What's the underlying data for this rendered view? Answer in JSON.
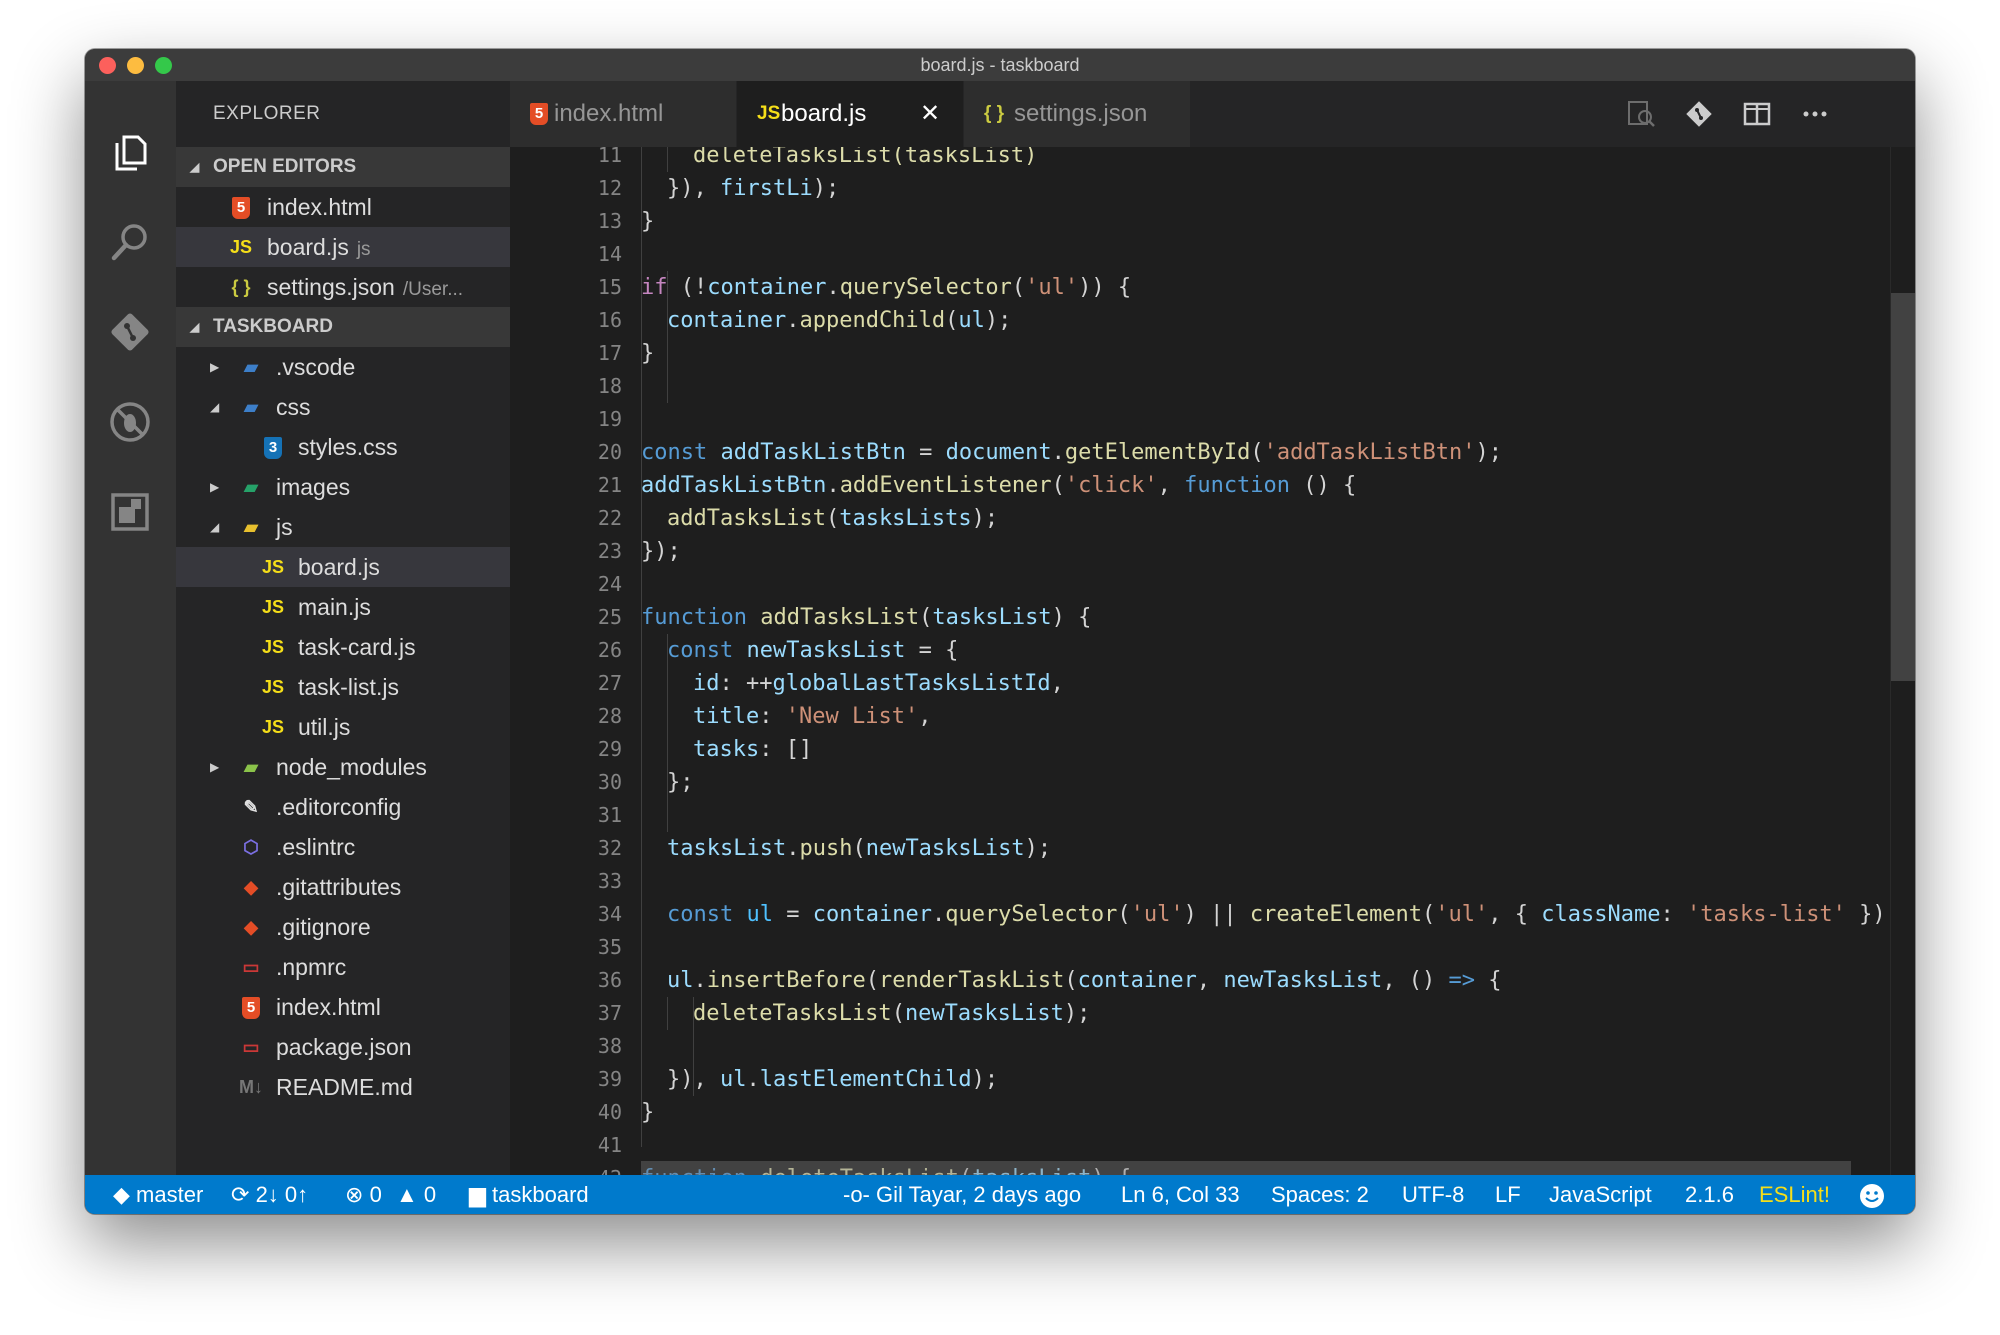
{
  "window": {
    "title": "board.js - taskboard"
  },
  "sidebar": {
    "title": "EXPLORER",
    "open_editors_label": "OPEN EDITORS",
    "open_editors": [
      {
        "icon": "html-file-icon",
        "name": "index.html",
        "desc": ""
      },
      {
        "icon": "js-file-icon",
        "name": "board.js",
        "desc": "js"
      },
      {
        "icon": "json-file-icon",
        "name": "settings.json",
        "desc": "/User..."
      }
    ],
    "project_label": "TASKBOARD",
    "tree": [
      {
        "name": ".vscode",
        "icon": "vscode-folder-icon",
        "depth": 1,
        "expanded": false,
        "folder": true
      },
      {
        "name": "css",
        "icon": "css-folder-icon",
        "depth": 1,
        "expanded": true,
        "folder": true
      },
      {
        "name": "styles.css",
        "icon": "css-file-icon",
        "depth": 2,
        "folder": false
      },
      {
        "name": "images",
        "icon": "images-folder-icon",
        "depth": 1,
        "expanded": false,
        "folder": true
      },
      {
        "name": "js",
        "icon": "js-folder-icon",
        "depth": 1,
        "expanded": true,
        "folder": true
      },
      {
        "name": "board.js",
        "icon": "js-file-icon",
        "depth": 2,
        "folder": false,
        "selected": true
      },
      {
        "name": "main.js",
        "icon": "js-file-icon",
        "depth": 2,
        "folder": false
      },
      {
        "name": "task-card.js",
        "icon": "js-file-icon",
        "depth": 2,
        "folder": false
      },
      {
        "name": "task-list.js",
        "icon": "js-file-icon",
        "depth": 2,
        "folder": false
      },
      {
        "name": "util.js",
        "icon": "js-file-icon",
        "depth": 2,
        "folder": false
      },
      {
        "name": "node_modules",
        "icon": "node-folder-icon",
        "depth": 1,
        "expanded": false,
        "folder": true
      },
      {
        "name": ".editorconfig",
        "icon": "editorconfig-file-icon",
        "depth": 1,
        "folder": false
      },
      {
        "name": ".eslintrc",
        "icon": "eslint-file-icon",
        "depth": 1,
        "folder": false
      },
      {
        "name": ".gitattributes",
        "icon": "git-file-icon",
        "depth": 1,
        "folder": false
      },
      {
        "name": ".gitignore",
        "icon": "git-file-icon",
        "depth": 1,
        "folder": false
      },
      {
        "name": ".npmrc",
        "icon": "npm-file-icon",
        "depth": 1,
        "folder": false
      },
      {
        "name": "index.html",
        "icon": "html-file-icon",
        "depth": 1,
        "folder": false
      },
      {
        "name": "package.json",
        "icon": "npm-file-icon",
        "depth": 1,
        "folder": false
      },
      {
        "name": "README.md",
        "icon": "markdown-file-icon",
        "depth": 1,
        "folder": false
      }
    ]
  },
  "tabs": [
    {
      "icon": "html-file-icon",
      "label": "index.html",
      "active": false
    },
    {
      "icon": "js-file-icon",
      "label": "board.js",
      "active": true,
      "close": "✕"
    },
    {
      "icon": "json-file-icon",
      "label": "settings.json",
      "active": false
    }
  ],
  "editor": {
    "lines": [
      {
        "n": "11",
        "indent": 2,
        "tokens": [
          [
            "deleteTasksList(tasksList)",
            "fn"
          ]
        ]
      },
      {
        "n": "12",
        "indent": 1,
        "tokens": [
          [
            "}), ",
            "p"
          ],
          [
            "firstLi",
            "var"
          ],
          [
            ");",
            "p"
          ]
        ]
      },
      {
        "n": "13",
        "indent": 0,
        "tokens": [
          [
            "}",
            "p"
          ]
        ]
      },
      {
        "n": "14",
        "indent": 0,
        "tokens": []
      },
      {
        "n": "15",
        "indent": 0,
        "tokens": [
          [
            "if",
            "ctl"
          ],
          [
            " (!",
            "p"
          ],
          [
            "container",
            "var"
          ],
          [
            ".",
            "p"
          ],
          [
            "querySelector",
            "fn"
          ],
          [
            "(",
            "p"
          ],
          [
            "'ul'",
            "str"
          ],
          [
            ")) {",
            "p"
          ]
        ]
      },
      {
        "n": "16",
        "indent": 1,
        "tokens": [
          [
            "container",
            "var"
          ],
          [
            ".",
            "p"
          ],
          [
            "appendChild",
            "fn"
          ],
          [
            "(",
            "p"
          ],
          [
            "ul",
            "var"
          ],
          [
            ");",
            "p"
          ]
        ]
      },
      {
        "n": "17",
        "indent": 0,
        "tokens": [
          [
            "}",
            "p"
          ]
        ]
      },
      {
        "n": "18",
        "indent": 0,
        "tokens": []
      },
      {
        "n": "19",
        "indent": 0,
        "tokens": []
      },
      {
        "n": "20",
        "indent": 0,
        "tokens": [
          [
            "const",
            "kw"
          ],
          [
            " ",
            "p"
          ],
          [
            "addTaskListBtn",
            "var"
          ],
          [
            " = ",
            "p"
          ],
          [
            "document",
            "var"
          ],
          [
            ".",
            "p"
          ],
          [
            "getElementById",
            "fn"
          ],
          [
            "(",
            "p"
          ],
          [
            "'addTaskListBtn'",
            "str"
          ],
          [
            ");",
            "p"
          ]
        ]
      },
      {
        "n": "21",
        "indent": 0,
        "tokens": [
          [
            "addTaskListBtn",
            "var"
          ],
          [
            ".",
            "p"
          ],
          [
            "addEventListener",
            "fn"
          ],
          [
            "(",
            "p"
          ],
          [
            "'click'",
            "str"
          ],
          [
            ", ",
            "p"
          ],
          [
            "function",
            "kw"
          ],
          [
            " () {",
            "p"
          ]
        ]
      },
      {
        "n": "22",
        "indent": 1,
        "tokens": [
          [
            "addTasksList",
            "fn"
          ],
          [
            "(",
            "p"
          ],
          [
            "tasksLists",
            "var"
          ],
          [
            ");",
            "p"
          ]
        ]
      },
      {
        "n": "23",
        "indent": 0,
        "tokens": [
          [
            "});",
            "p"
          ]
        ]
      },
      {
        "n": "24",
        "indent": 0,
        "tokens": []
      },
      {
        "n": "25",
        "indent": 0,
        "tokens": [
          [
            "function",
            "kw"
          ],
          [
            " ",
            "p"
          ],
          [
            "addTasksList",
            "fn"
          ],
          [
            "(",
            "p"
          ],
          [
            "tasksList",
            "var"
          ],
          [
            ") {",
            "p"
          ]
        ]
      },
      {
        "n": "26",
        "indent": 1,
        "tokens": [
          [
            "const",
            "kw"
          ],
          [
            " ",
            "p"
          ],
          [
            "newTasksList",
            "var"
          ],
          [
            " = {",
            "p"
          ]
        ]
      },
      {
        "n": "27",
        "indent": 2,
        "tokens": [
          [
            "id",
            "var"
          ],
          [
            ": ++",
            "p"
          ],
          [
            "globalLastTasksListId",
            "var"
          ],
          [
            ",",
            "p"
          ]
        ]
      },
      {
        "n": "28",
        "indent": 2,
        "tokens": [
          [
            "title",
            "var"
          ],
          [
            ": ",
            "p"
          ],
          [
            "'New List'",
            "str"
          ],
          [
            ",",
            "p"
          ]
        ]
      },
      {
        "n": "29",
        "indent": 2,
        "tokens": [
          [
            "tasks",
            "var"
          ],
          [
            ": []",
            "p"
          ]
        ]
      },
      {
        "n": "30",
        "indent": 1,
        "tokens": [
          [
            "};",
            "p"
          ]
        ]
      },
      {
        "n": "31",
        "indent": 0,
        "tokens": []
      },
      {
        "n": "32",
        "indent": 1,
        "tokens": [
          [
            "tasksList",
            "var"
          ],
          [
            ".",
            "p"
          ],
          [
            "push",
            "fn"
          ],
          [
            "(",
            "p"
          ],
          [
            "newTasksList",
            "var"
          ],
          [
            ");",
            "p"
          ]
        ]
      },
      {
        "n": "33",
        "indent": 0,
        "tokens": []
      },
      {
        "n": "34",
        "indent": 1,
        "tokens": [
          [
            "const",
            "kw"
          ],
          [
            " ",
            "p"
          ],
          [
            "ul",
            "const"
          ],
          [
            " = ",
            "p"
          ],
          [
            "container",
            "var"
          ],
          [
            ".",
            "p"
          ],
          [
            "querySelector",
            "fn"
          ],
          [
            "(",
            "p"
          ],
          [
            "'ul'",
            "str"
          ],
          [
            ") || ",
            "p"
          ],
          [
            "createElement",
            "fn"
          ],
          [
            "(",
            "p"
          ],
          [
            "'ul'",
            "str"
          ],
          [
            ", { ",
            "p"
          ],
          [
            "className",
            "var"
          ],
          [
            ": ",
            "p"
          ],
          [
            "'tasks-list'",
            "str"
          ],
          [
            " });",
            "p"
          ]
        ]
      },
      {
        "n": "35",
        "indent": 0,
        "tokens": []
      },
      {
        "n": "36",
        "indent": 1,
        "tokens": [
          [
            "ul",
            "var"
          ],
          [
            ".",
            "p"
          ],
          [
            "insertBefore",
            "fn"
          ],
          [
            "(",
            "p"
          ],
          [
            "renderTaskList",
            "fn"
          ],
          [
            "(",
            "p"
          ],
          [
            "container",
            "var"
          ],
          [
            ", ",
            "p"
          ],
          [
            "newTasksList",
            "var"
          ],
          [
            ", () ",
            "p"
          ],
          [
            "=>",
            "kw"
          ],
          [
            " {",
            "p"
          ]
        ]
      },
      {
        "n": "37",
        "indent": 2,
        "tokens": [
          [
            "deleteTasksList",
            "fn"
          ],
          [
            "(",
            "p"
          ],
          [
            "newTasksList",
            "var"
          ],
          [
            ");",
            "p"
          ]
        ]
      },
      {
        "n": "38",
        "indent": 0,
        "tokens": []
      },
      {
        "n": "39",
        "indent": 1,
        "tokens": [
          [
            "}), ",
            "p"
          ],
          [
            "ul",
            "var"
          ],
          [
            ".",
            "p"
          ],
          [
            "lastElementChild",
            "var"
          ],
          [
            ");",
            "p"
          ]
        ]
      },
      {
        "n": "40",
        "indent": 0,
        "tokens": [
          [
            "}",
            "p"
          ]
        ]
      },
      {
        "n": "41",
        "indent": 0,
        "tokens": []
      },
      {
        "n": "42",
        "indent": 0,
        "tokens": [
          [
            "function",
            "kw"
          ],
          [
            " ",
            "p"
          ],
          [
            "deleteTasksList",
            "fn"
          ],
          [
            "(",
            "p"
          ],
          [
            "tasksList",
            "var"
          ],
          [
            ") {",
            "p"
          ]
        ]
      }
    ]
  },
  "statusbar": {
    "branch": "master",
    "sync": "2↓ 0↑",
    "errors": "0",
    "warnings": "0",
    "folder": "taskboard",
    "blame": "Gil Tayar, 2 days ago",
    "position": "Ln 6, Col 33",
    "spaces": "Spaces: 2",
    "encoding": "UTF-8",
    "eol": "LF",
    "language": "JavaScript",
    "version": "2.1.6",
    "eslint": "ESLint!"
  },
  "colors": {
    "accent": "#007acc",
    "js": "#f5de19",
    "html": "#e44d26",
    "css": "#1572b6",
    "json": "#cbcb41",
    "eslint_status": "#f5de19"
  }
}
